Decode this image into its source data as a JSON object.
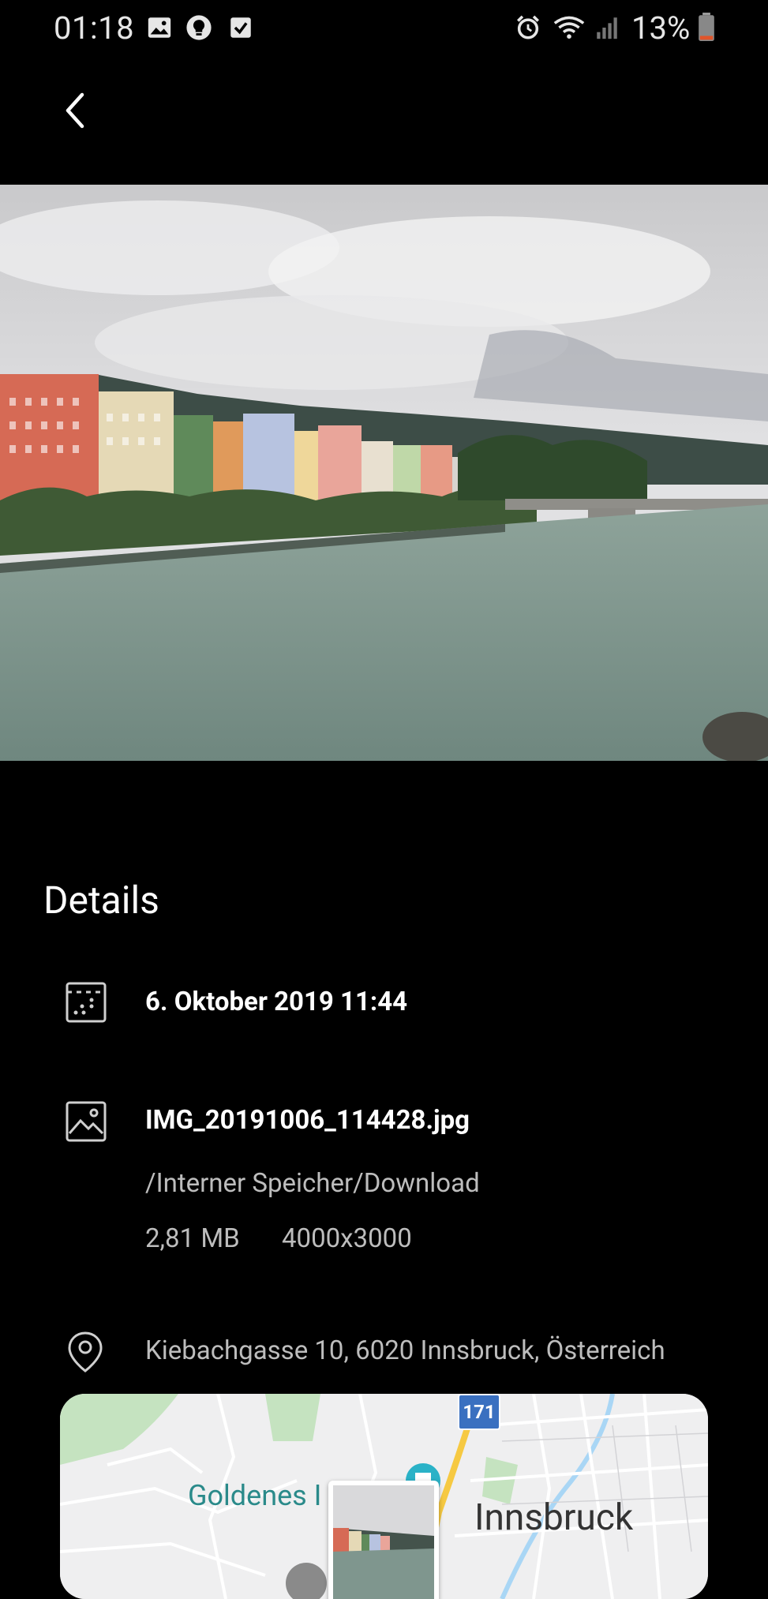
{
  "status_bar": {
    "time": "01:18",
    "battery": "13%",
    "icons": [
      "image-icon",
      "bulb-icon",
      "check-icon",
      "alarm-icon",
      "wifi-icon",
      "signal-icon",
      "battery-icon"
    ]
  },
  "header": {
    "back_icon": "chevron-left-icon"
  },
  "details": {
    "title": "Details",
    "date": "6. Oktober 2019 11:44",
    "file_name": "IMG_20191006_114428.jpg",
    "path": "/Interner Speicher/Download",
    "size": "2,81 MB",
    "resolution": "4000x3000",
    "location": "Kiebachgasse 10, 6020 Innsbruck, Österreich"
  },
  "map": {
    "label_left": "Goldenes I",
    "label_city": "Innsbruck",
    "road_number": "171"
  },
  "colors": {
    "background": "#000000",
    "text_primary": "#ffffff",
    "text_secondary": "#bdbdbd",
    "map_bg": "#efeff0",
    "map_water": "#aadaff",
    "map_green": "#c8e6c9",
    "map_teal_label": "#2a8a8a"
  }
}
